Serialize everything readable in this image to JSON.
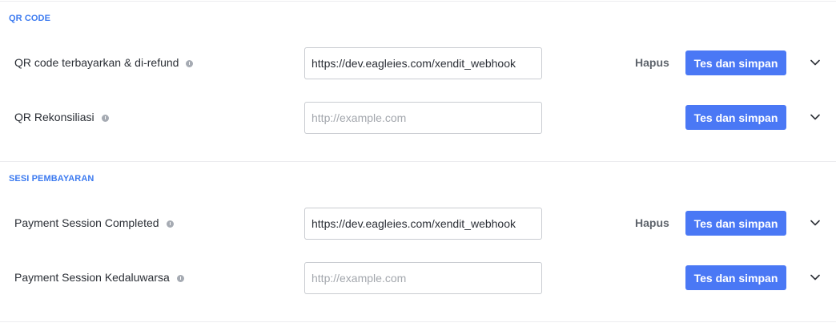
{
  "sections": [
    {
      "title": "QR CODE",
      "rows": [
        {
          "label": "QR code terbayarkan & di-refund",
          "value": "https://dev.eagleies.com/xendit_webhook",
          "placeholder": "http://example.com",
          "delete_label": "Hapus",
          "save_label": "Tes dan simpan"
        },
        {
          "label": "QR Rekonsiliasi",
          "value": "",
          "placeholder": "http://example.com",
          "delete_label": "",
          "save_label": "Tes dan simpan"
        }
      ]
    },
    {
      "title": "SESI PEMBAYARAN",
      "rows": [
        {
          "label": "Payment Session Completed",
          "value": "https://dev.eagleies.com/xendit_webhook",
          "placeholder": "http://example.com",
          "delete_label": "Hapus",
          "save_label": "Tes dan simpan"
        },
        {
          "label": "Payment Session Kedaluwarsa",
          "value": "",
          "placeholder": "http://example.com",
          "delete_label": "",
          "save_label": "Tes dan simpan"
        }
      ]
    }
  ],
  "icons": {
    "info": "info-icon",
    "expand": "chevron-down-icon"
  },
  "colors": {
    "accent": "#4a78f5",
    "section_title": "#3d7bf0",
    "info_icon": "#a6abb3"
  }
}
